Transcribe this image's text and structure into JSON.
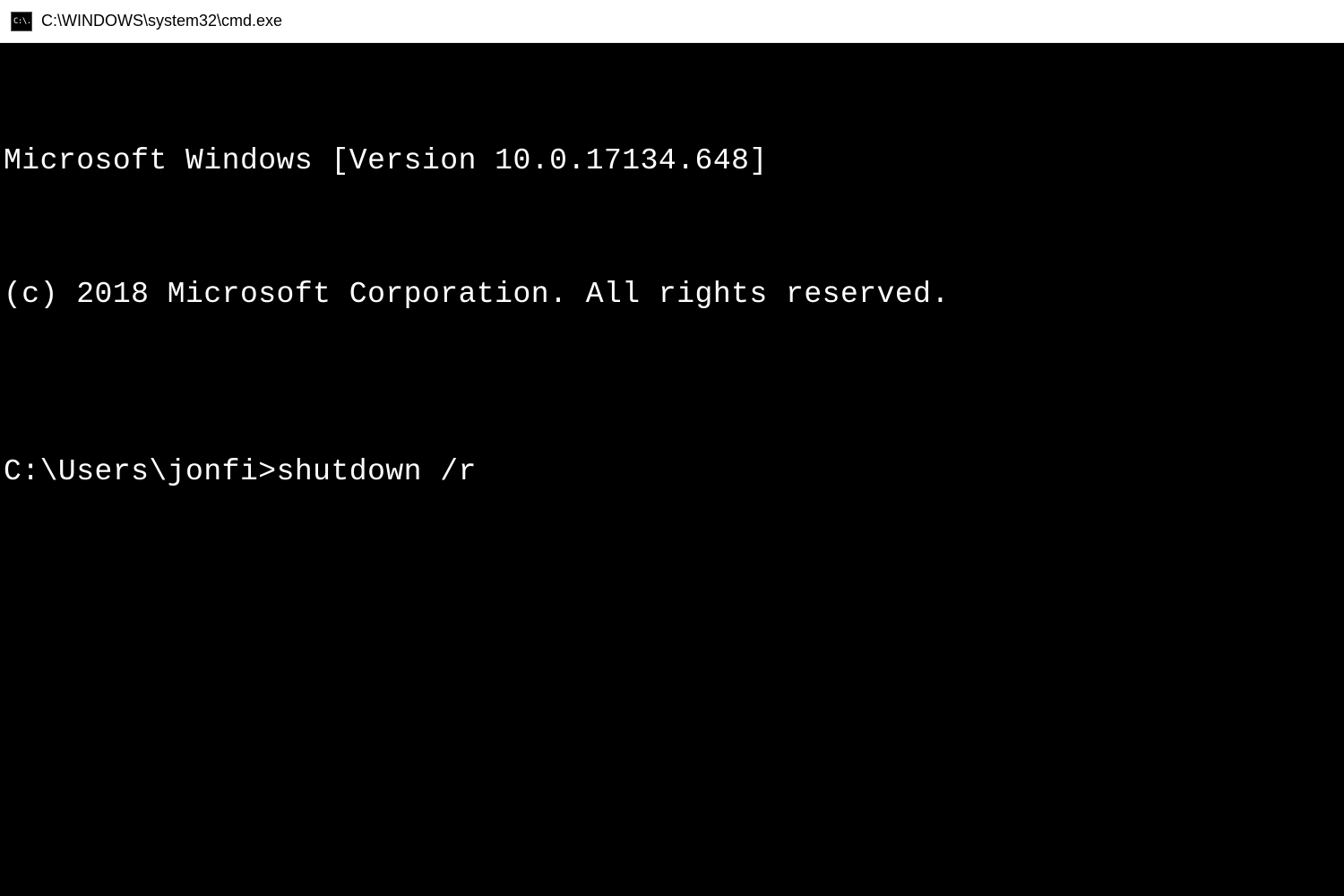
{
  "title_bar": {
    "icon_text": "C:\\.",
    "title": "C:\\WINDOWS\\system32\\cmd.exe"
  },
  "terminal": {
    "version_line": "Microsoft Windows [Version 10.0.17134.648]",
    "copyright_line": "(c) 2018 Microsoft Corporation. All rights reserved.",
    "prompt": "C:\\Users\\jonfi>",
    "command": "shutdown /r"
  }
}
